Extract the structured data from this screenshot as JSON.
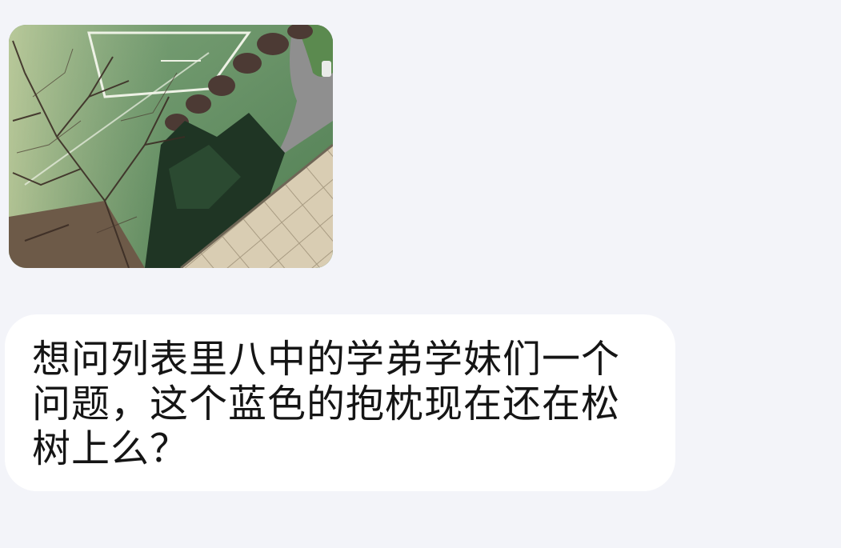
{
  "chat": {
    "messages": [
      {
        "type": "image",
        "image_description_icon": "photo-thumbnail"
      },
      {
        "type": "text",
        "text": "想问列表里八中的学弟学妹们一个问题，这个蓝色的抱枕现在还在松树上么？"
      }
    ]
  },
  "colors": {
    "background": "#f3f4f9",
    "bubble": "#ffffff",
    "text": "#151515"
  }
}
